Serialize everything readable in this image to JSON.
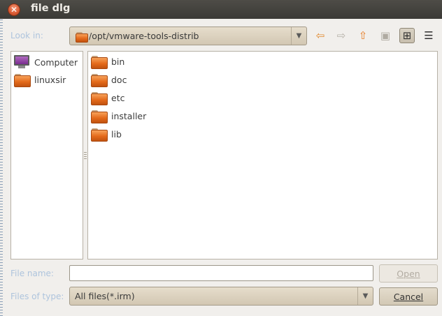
{
  "window": {
    "title": "file dlg",
    "close_glyph": "✕"
  },
  "look_in": {
    "label": "Look in:",
    "path": "/opt/vmware-tools-distrib",
    "arrow": "▼"
  },
  "toolbar": {
    "back_glyph": "⇦",
    "forward_glyph": "⇨",
    "up_glyph": "⇧",
    "new_folder_glyph": "▣",
    "icon_view_glyph": "⊞",
    "detail_view_glyph": "☰",
    "icons": [
      "back-arrow-icon",
      "forward-arrow-icon",
      "up-arrow-icon",
      "new-folder-icon",
      "icon-view-icon",
      "detail-view-icon"
    ]
  },
  "sidebar": {
    "items": [
      {
        "label": "Computer",
        "icon": "computer-icon"
      },
      {
        "label": "linuxsir",
        "icon": "folder-icon"
      }
    ]
  },
  "files": {
    "items": [
      {
        "label": "bin",
        "icon": "folder-icon"
      },
      {
        "label": "doc",
        "icon": "folder-icon"
      },
      {
        "label": "etc",
        "icon": "folder-icon"
      },
      {
        "label": "installer",
        "icon": "folder-icon"
      },
      {
        "label": "lib",
        "icon": "folder-icon"
      }
    ]
  },
  "file_name": {
    "label": "File name:",
    "value": ""
  },
  "file_type": {
    "label": "Files of type:",
    "value": "All files(*.irm)",
    "arrow": "▼"
  },
  "buttons": {
    "open": "Open",
    "cancel": "Cancel"
  },
  "colors": {
    "title_bar": "#3b3a36",
    "label_disabled": "#aec4dd",
    "folder": "#e46a1b",
    "close_button": "#d95a33"
  }
}
